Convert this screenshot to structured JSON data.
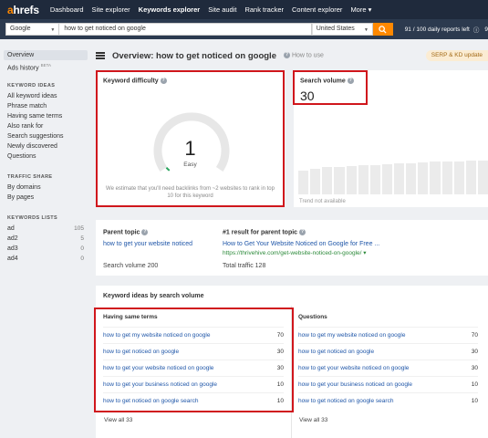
{
  "nav": {
    "logo_a": "a",
    "logo_rest": "hrefs",
    "links": [
      "Dashboard",
      "Site explorer",
      "Keywords explorer",
      "Site audit",
      "Rank tracker",
      "Content explorer",
      "More"
    ],
    "more_caret": "▾"
  },
  "search": {
    "engine": "Google",
    "keyword": "how to get noticed on google",
    "country": "United States",
    "reports_left": "91 / 100 daily reports left",
    "reports_extra": "9"
  },
  "sidebar": {
    "overview": "Overview",
    "ads_history": "Ads history",
    "ads_beta": "BETA",
    "keyword_ideas_head": "KEYWORD IDEAS",
    "keyword_ideas": [
      "All keyword ideas",
      "Phrase match",
      "Having same terms",
      "Also rank for",
      "Search suggestions",
      "Newly discovered",
      "Questions"
    ],
    "traffic_share_head": "TRAFFIC SHARE",
    "traffic_share": [
      "By domains",
      "By pages"
    ],
    "keyword_lists_head": "KEYWORDS LISTS",
    "keyword_lists": [
      {
        "name": "ad",
        "count": "105"
      },
      {
        "name": "ad2",
        "count": "5"
      },
      {
        "name": "ad3",
        "count": "0"
      },
      {
        "name": "ad4",
        "count": "0"
      }
    ]
  },
  "header": {
    "title": "Overview: how to get noticed on google",
    "how_to_use": "How to use",
    "serp_badge": "SERP & KD update"
  },
  "kd": {
    "title": "Keyword difficulty",
    "value": "1",
    "label": "Easy",
    "note": "We estimate that you'll need backlinks from ~2 websites to rank in top 10 for this keyword",
    "score": 1
  },
  "volume": {
    "title": "Search volume",
    "value": "30",
    "trend_note": "Trend not available"
  },
  "parent": {
    "topic_label": "Parent topic",
    "topic_link": "how to get your website noticed",
    "topic_volume": "Search volume 200",
    "result_label": "#1 result for parent topic",
    "result_title": "How to Get Your Website Noticed on Google for Free ...",
    "result_url": "https://thrivehive.com/get-website-noticed-on-google/ ▾",
    "result_traffic": "Total traffic 128"
  },
  "ideas": {
    "title": "Keyword ideas by search volume",
    "same_terms_head": "Having same terms",
    "questions_head": "Questions",
    "same_terms": [
      {
        "kw": "how to get my website noticed on google",
        "vol": "70"
      },
      {
        "kw": "how to get noticed on google",
        "vol": "30"
      },
      {
        "kw": "how to get your website noticed on google",
        "vol": "30"
      },
      {
        "kw": "how to get your business noticed on google",
        "vol": "10"
      },
      {
        "kw": "how to get noticed on google search",
        "vol": "10"
      }
    ],
    "questions": [
      {
        "kw": "how to get my website noticed on google",
        "vol": "70"
      },
      {
        "kw": "how to get noticed on google",
        "vol": "30"
      },
      {
        "kw": "how to get your website noticed on google",
        "vol": "30"
      },
      {
        "kw": "how to get your business noticed on google",
        "vol": "10"
      },
      {
        "kw": "how to get noticed on google search",
        "vol": "10"
      }
    ],
    "view_all": "View all 33"
  },
  "colors": {
    "nav_bg": "#1f2a3c",
    "accent": "#ff8800",
    "link": "#1f56a8",
    "highlight": "#d0161c",
    "gauge_green": "#2aa55e"
  }
}
